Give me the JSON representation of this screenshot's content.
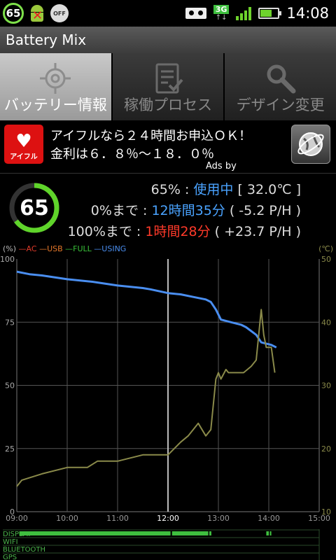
{
  "statusbar": {
    "battery_level": "65",
    "off_label": "OFF",
    "network": "3G",
    "time": "14:08",
    "icons": [
      "battery-ring-icon",
      "android-error-icon",
      "power-off-icon",
      "voicemail-icon",
      "network-3g-icon",
      "signal-icon",
      "battery-icon"
    ]
  },
  "app": {
    "title": "Battery Mix"
  },
  "tabs": [
    {
      "label": "バッテリー情報",
      "icon": "target-icon",
      "active": true
    },
    {
      "label": "稼働プロセス",
      "icon": "checklist-icon",
      "active": false
    },
    {
      "label": "デザイン変更",
      "icon": "wrench-icon",
      "active": false
    }
  ],
  "ad": {
    "logo_text": "アイフル",
    "line1": "アイフルなら２４時間お申込ＯＫ！",
    "line2": "金利は６．８％～１８．０％",
    "ads_by": "Ads by"
  },
  "status": {
    "level": "65",
    "line1": {
      "pct": "65%",
      "sep": " : ",
      "state": "使用中",
      "temp": " [ 32.0℃ ]"
    },
    "line2": {
      "pre": "0%まで",
      "sep": " : ",
      "time": "12時間35分",
      "rate": " ( -5.2 P/H )"
    },
    "line3": {
      "pre": "100%まで",
      "sep": " : ",
      "time": "1時間28分",
      "rate": " ( +23.7 P/H )"
    }
  },
  "legend": {
    "unit_left": "(%)",
    "unit_right": "(℃)",
    "items": [
      {
        "label": "AC",
        "color": "#e23b2a"
      },
      {
        "label": "USB",
        "color": "#e6782a"
      },
      {
        "label": "FULL",
        "color": "#39c139"
      },
      {
        "label": "USING",
        "color": "#4a8ef0"
      }
    ]
  },
  "chart_data": {
    "type": "line",
    "x_ticks": [
      "09:00",
      "10:00",
      "11:00",
      "12:00",
      "13:00",
      "14:00",
      "15:00"
    ],
    "y_ticks": [
      0,
      25,
      50,
      75,
      100
    ],
    "y2_ticks": [
      10,
      20,
      30,
      40,
      50
    ],
    "xlim": [
      9,
      15
    ],
    "ylim": [
      0,
      100
    ],
    "y2lim": [
      10,
      50
    ],
    "grid": true,
    "series": [
      {
        "name": "USING",
        "color": "#4a8ef0",
        "axis": "left",
        "x": [
          9.0,
          9.25,
          9.5,
          10.0,
          10.5,
          11.0,
          11.5,
          11.65,
          12.0,
          12.25,
          12.5,
          12.75,
          12.85,
          12.95,
          13.05,
          13.25,
          13.45,
          13.55,
          13.75,
          13.85,
          13.95,
          14.05,
          14.15
        ],
        "y": [
          95,
          94,
          93.5,
          92,
          91,
          89.5,
          88.5,
          88,
          86.5,
          86,
          85,
          84,
          83,
          80,
          76,
          75,
          74,
          73,
          70,
          67,
          66.5,
          66,
          65
        ]
      },
      {
        "name": "Temperature",
        "color": "#8a8a4a",
        "axis": "right",
        "x": [
          9.0,
          9.1,
          9.5,
          10.0,
          10.4,
          10.6,
          11.0,
          11.25,
          11.5,
          12.0,
          12.25,
          12.4,
          12.6,
          12.75,
          12.85,
          12.95,
          13.0,
          13.05,
          13.15,
          13.2,
          13.3,
          13.5,
          13.65,
          13.75,
          13.85,
          13.9,
          13.95,
          14.0,
          14.05,
          14.12
        ],
        "y": [
          14,
          15,
          16,
          17,
          17,
          18,
          18,
          18.5,
          19,
          19,
          21,
          22,
          24,
          22,
          23,
          31,
          32,
          31,
          32.5,
          32,
          32,
          32,
          33,
          34,
          42,
          38,
          36,
          36,
          36,
          32
        ]
      }
    ]
  },
  "activity": {
    "rows": [
      {
        "label": "DISPLAY",
        "color": "#3fbf3f",
        "segments": [
          [
            9.05,
            12.05
          ],
          [
            12.08,
            12.8
          ],
          [
            12.82,
            12.86
          ],
          [
            13.95,
            14.0
          ],
          [
            14.02,
            14.05
          ]
        ]
      },
      {
        "label": "WIFI",
        "color": "#3fbf3f",
        "segments": []
      },
      {
        "label": "BLUETOOTH",
        "color": "#3fbf3f",
        "segments": []
      },
      {
        "label": "GPS",
        "color": "#3fbf3f",
        "segments": []
      }
    ]
  }
}
